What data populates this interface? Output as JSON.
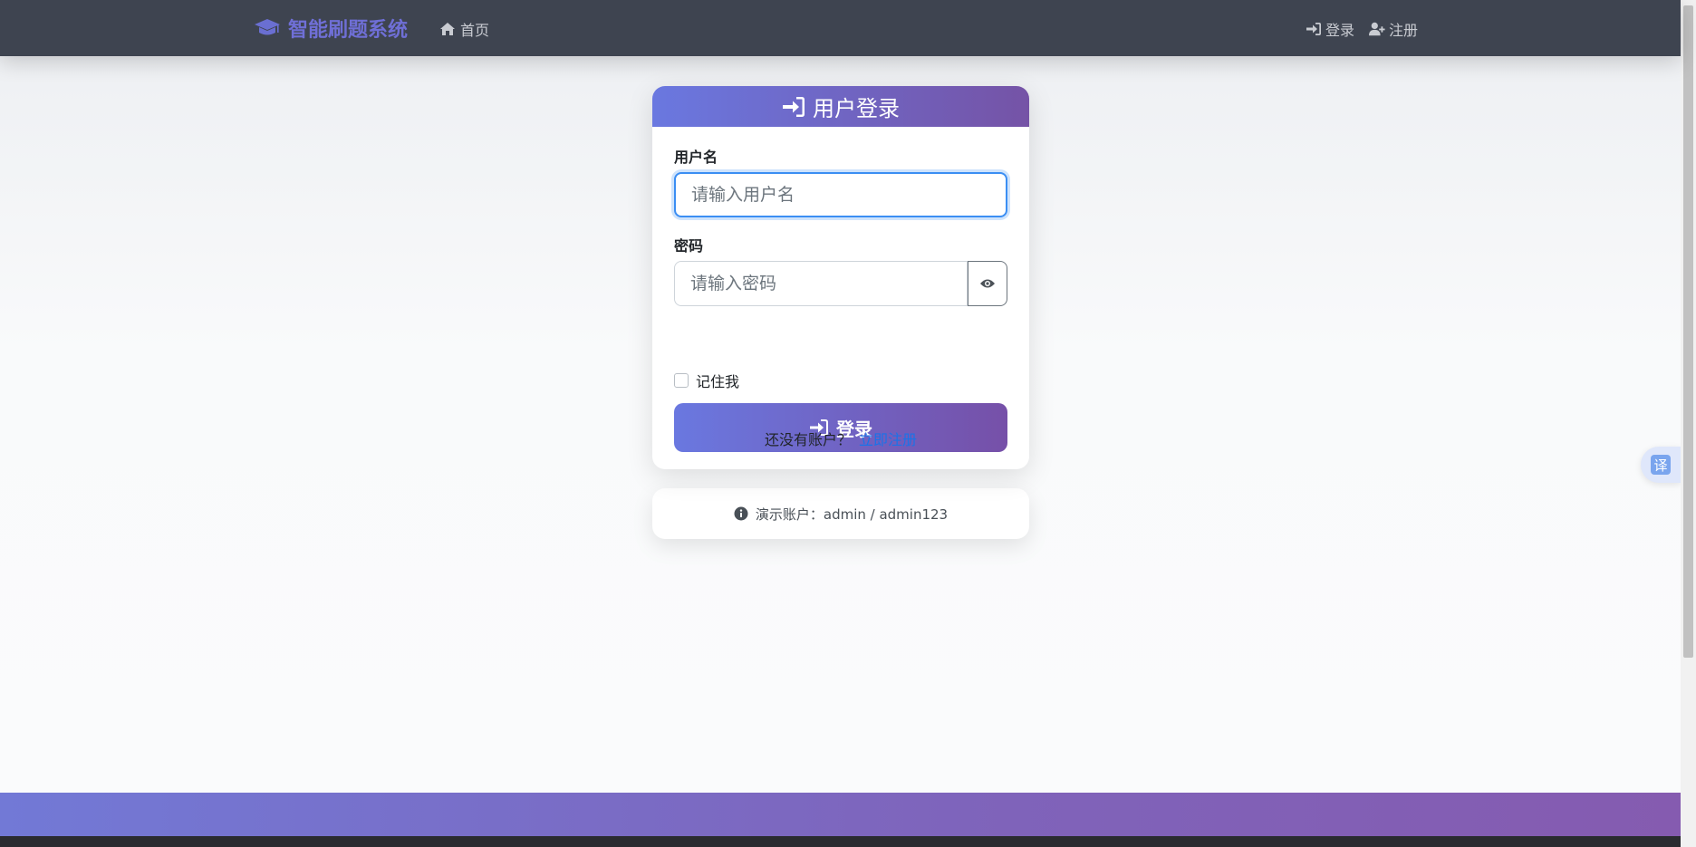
{
  "navbar": {
    "brand": "智能刷题系统",
    "home_label": "首页",
    "login_label": "登录",
    "register_label": "注册"
  },
  "login_card": {
    "title": "用户登录",
    "username_label": "用户名",
    "username_placeholder": "请输入用户名",
    "username_value": "",
    "password_label": "密码",
    "password_placeholder": "请输入密码",
    "password_value": "",
    "remember_label": "记住我",
    "remember_checked": false,
    "submit_label": "登录",
    "no_account_text": "还没有账户？",
    "register_link": "立即注册"
  },
  "demo": {
    "text": "演示账户：admin / admin123"
  },
  "translate": {
    "label": "译"
  },
  "colors": {
    "navbar_bg": "#3e4450",
    "brand_color": "#6f6fd6",
    "gradient_start": "#6a78e0",
    "gradient_end": "#7553a6",
    "link_blue": "#1a73e8",
    "focus_blue": "#3b8ef3"
  },
  "icons": {
    "brand": "graduation-cap-icon",
    "home": "home-icon",
    "login": "sign-in-icon",
    "register": "user-plus-icon",
    "password_toggle": "eye-icon",
    "demo_info": "info-circle-icon"
  }
}
